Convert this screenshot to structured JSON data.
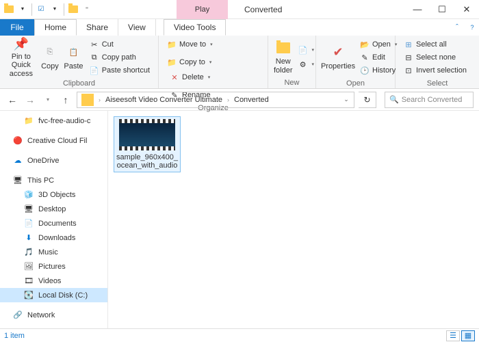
{
  "window": {
    "title": "Converted",
    "context_label": "Play",
    "context_tab": "Video Tools"
  },
  "tabs": {
    "file": "File",
    "home": "Home",
    "share": "Share",
    "view": "View"
  },
  "ribbon": {
    "clipboard": {
      "label": "Clipboard",
      "pin": "Pin to Quick access",
      "copy": "Copy",
      "paste": "Paste",
      "cut": "Cut",
      "copy_path": "Copy path",
      "paste_shortcut": "Paste shortcut"
    },
    "organize": {
      "label": "Organize",
      "move_to": "Move to",
      "copy_to": "Copy to",
      "delete": "Delete",
      "rename": "Rename"
    },
    "new": {
      "label": "New",
      "new_folder": "New folder"
    },
    "open": {
      "label": "Open",
      "properties": "Properties",
      "open": "Open",
      "edit": "Edit",
      "history": "History"
    },
    "select": {
      "label": "Select",
      "all": "Select all",
      "none": "Select none",
      "invert": "Invert selection"
    }
  },
  "address": {
    "segments": [
      "Aiseesoft Video Converter Ultimate",
      "Converted"
    ],
    "search_placeholder": "Search Converted"
  },
  "nav": {
    "items": [
      {
        "label": "fvc-free-audio-c",
        "icon": "folder",
        "indent": true
      },
      {
        "label": "Creative Cloud Fil",
        "icon": "cc",
        "indent": false
      },
      {
        "label": "OneDrive",
        "icon": "onedrive",
        "indent": false
      },
      {
        "label": "This PC",
        "icon": "pc",
        "indent": false
      },
      {
        "label": "3D Objects",
        "icon": "3d",
        "indent": true
      },
      {
        "label": "Desktop",
        "icon": "desktop",
        "indent": true
      },
      {
        "label": "Documents",
        "icon": "docs",
        "indent": true
      },
      {
        "label": "Downloads",
        "icon": "downloads",
        "indent": true
      },
      {
        "label": "Music",
        "icon": "music",
        "indent": true
      },
      {
        "label": "Pictures",
        "icon": "pictures",
        "indent": true
      },
      {
        "label": "Videos",
        "icon": "videos",
        "indent": true
      },
      {
        "label": "Local Disk (C:)",
        "icon": "disk",
        "indent": true,
        "selected": true
      },
      {
        "label": "Network",
        "icon": "network",
        "indent": false
      }
    ]
  },
  "files": [
    {
      "name": "sample_960x400_ocean_with_audio"
    }
  ],
  "status": {
    "count": "1 item"
  }
}
